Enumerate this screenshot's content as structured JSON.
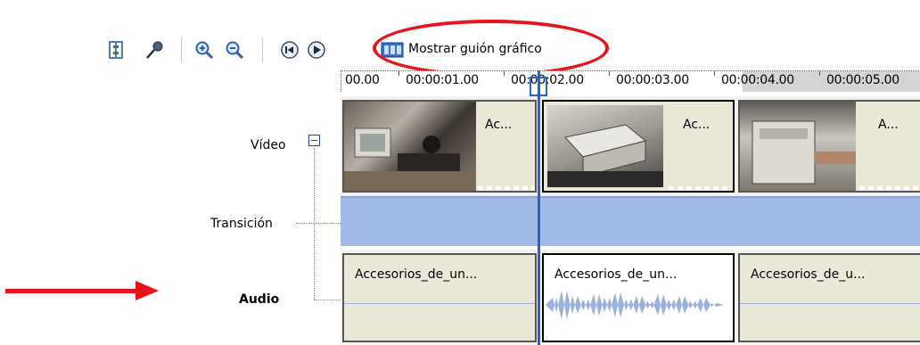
{
  "toolbar": {
    "buttons": [
      {
        "name": "set-levels-button",
        "icon": "audio-levels-icon"
      },
      {
        "name": "narrate-button",
        "icon": "microphone-icon"
      },
      {
        "name": "zoom-in-button",
        "icon": "zoom-in-icon"
      },
      {
        "name": "zoom-out-button",
        "icon": "zoom-out-icon"
      },
      {
        "name": "rewind-button",
        "icon": "rewind-icon"
      },
      {
        "name": "play-button",
        "icon": "play-icon"
      }
    ],
    "storyboard_label": "Mostrar guión gráfico"
  },
  "ruler": {
    "labels": [
      "00.00",
      "00:00:01.00",
      "00:00:02.00",
      "00:00:03.00",
      "00:00:04.00",
      "00:00:05.00"
    ],
    "playhead_time": "00:00:02.00"
  },
  "tracks": {
    "video": {
      "label": "Vídeo",
      "collapse_symbol": "⊟"
    },
    "transition": {
      "label": "Transición"
    },
    "audio": {
      "label": "Audio"
    }
  },
  "video_clips": [
    {
      "title": "Ac...",
      "selected": false
    },
    {
      "title": "Ac...",
      "selected": true
    },
    {
      "title": "A...",
      "selected": false
    }
  ],
  "audio_clips": [
    {
      "title": "Accesorios_de_un...",
      "selected": false
    },
    {
      "title": "Accesorios_de_un...",
      "selected": true
    },
    {
      "title": "Accesorios_de_u...",
      "selected": false
    }
  ],
  "colors": {
    "annotation": "#e8141c",
    "playhead": "#2a62c4",
    "transition_track": "#a3b9e6",
    "waveform": "#9bb1dd"
  }
}
